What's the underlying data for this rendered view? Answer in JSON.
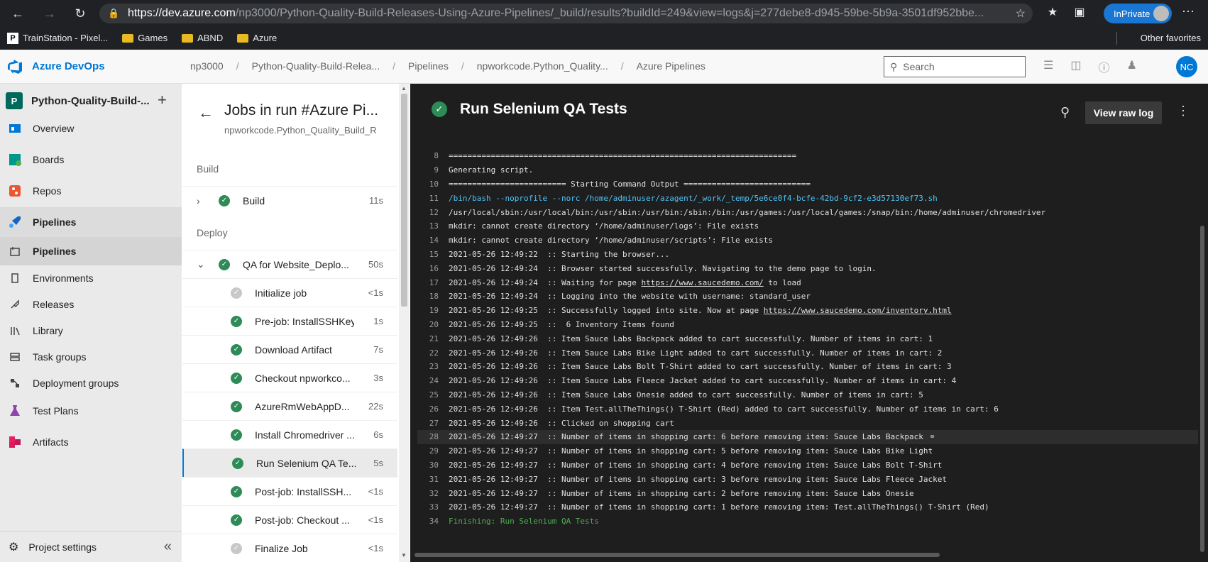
{
  "browser": {
    "url_host": "https://dev.azure.com",
    "url_path": "/np3000/Python-Quality-Build-Releases-Using-Azure-Pipelines/_build/results?buildId=249&view=logs&j=277debe8-d945-59be-5b9a-3501df952bbe...",
    "inprivate": "InPrivate",
    "bookmarks": [
      "TrainStation - Pixel...",
      "Games",
      "ABND",
      "Azure"
    ],
    "other_favorites": "Other favorites"
  },
  "ado": {
    "brand": "Azure DevOps",
    "breadcrumbs": [
      "np3000",
      "Python-Quality-Build-Relea...",
      "Pipelines",
      "npworkcode.Python_Quality...",
      "Azure Pipelines"
    ],
    "search_placeholder": "Search",
    "avatar_initials": "NC"
  },
  "sidebar": {
    "project_badge": "P",
    "project_name": "Python-Quality-Build-...",
    "items": [
      {
        "label": "Overview"
      },
      {
        "label": "Boards"
      },
      {
        "label": "Repos"
      },
      {
        "label": "Pipelines"
      },
      {
        "label": "Pipelines"
      },
      {
        "label": "Environments"
      },
      {
        "label": "Releases"
      },
      {
        "label": "Library"
      },
      {
        "label": "Task groups"
      },
      {
        "label": "Deployment groups"
      },
      {
        "label": "Test Plans"
      },
      {
        "label": "Artifacts"
      }
    ],
    "project_settings": "Project settings"
  },
  "jobs": {
    "title": "Jobs in run #Azure Pi...",
    "subtitle": "npworkcode.Python_Quality_Build_R",
    "build_section": "Build",
    "deploy_section": "Deploy",
    "rows": [
      {
        "label": "Build",
        "duration": "11s"
      },
      {
        "label": "QA for Website_Deplo...",
        "duration": "50s"
      },
      {
        "label": "Initialize job",
        "duration": "<1s"
      },
      {
        "label": "Pre-job: InstallSSHKey",
        "duration": "1s"
      },
      {
        "label": "Download Artifact",
        "duration": "7s"
      },
      {
        "label": "Checkout npworkco...",
        "duration": "3s"
      },
      {
        "label": "AzureRmWebAppD...",
        "duration": "22s"
      },
      {
        "label": "Install Chromedriver ...",
        "duration": "6s"
      },
      {
        "label": "Run Selenium QA Te...",
        "duration": "5s"
      },
      {
        "label": "Post-job: InstallSSH...",
        "duration": "<1s"
      },
      {
        "label": "Post-job: Checkout ...",
        "duration": "<1s"
      },
      {
        "label": "Finalize Job",
        "duration": "<1s"
      }
    ]
  },
  "log": {
    "title": "Run Selenium QA Tests",
    "raw_log_button": "View raw log",
    "lines": [
      {
        "n": "8",
        "t": "=========================================================================="
      },
      {
        "n": "9",
        "t": "Generating script."
      },
      {
        "n": "10",
        "t": "========================= Starting Command Output ==========================="
      },
      {
        "n": "11",
        "t": "/bin/bash --noprofile --norc /home/adminuser/azagent/_work/_temp/5e6ce0f4-bcfe-42bd-9cf2-e3d57130ef73.sh"
      },
      {
        "n": "12",
        "t": "/usr/local/sbin:/usr/local/bin:/usr/sbin:/usr/bin:/sbin:/bin:/usr/games:/usr/local/games:/snap/bin:/home/adminuser/chromedriver"
      },
      {
        "n": "13",
        "t": "mkdir: cannot create directory ‘/home/adminuser/logs’: File exists"
      },
      {
        "n": "14",
        "t": "mkdir: cannot create directory ‘/home/adminuser/scripts’: File exists"
      },
      {
        "n": "15",
        "t": "2021-05-26 12:49:22  :: Starting the browser..."
      },
      {
        "n": "16",
        "t": "2021-05-26 12:49:24  :: Browser started successfully. Navigating to the demo page to login."
      },
      {
        "n": "17",
        "t": "2021-05-26 12:49:24  :: Waiting for page ",
        "link": "https://www.saucedemo.com/",
        "tail": " to load"
      },
      {
        "n": "18",
        "t": "2021-05-26 12:49:24  :: Logging into the website with username: standard_user"
      },
      {
        "n": "19",
        "t": "2021-05-26 12:49:25  :: Successfully logged into site. Now at page ",
        "link": "https://www.saucedemo.com/inventory.html",
        "tail": ""
      },
      {
        "n": "20",
        "t": "2021-05-26 12:49:25  ::  6 Inventory Items found"
      },
      {
        "n": "21",
        "t": "2021-05-26 12:49:26  :: Item Sauce Labs Backpack added to cart successfully. Number of items in cart: 1"
      },
      {
        "n": "22",
        "t": "2021-05-26 12:49:26  :: Item Sauce Labs Bike Light added to cart successfully. Number of items in cart: 2"
      },
      {
        "n": "23",
        "t": "2021-05-26 12:49:26  :: Item Sauce Labs Bolt T-Shirt added to cart successfully. Number of items in cart: 3"
      },
      {
        "n": "24",
        "t": "2021-05-26 12:49:26  :: Item Sauce Labs Fleece Jacket added to cart successfully. Number of items in cart: 4"
      },
      {
        "n": "25",
        "t": "2021-05-26 12:49:26  :: Item Sauce Labs Onesie added to cart successfully. Number of items in cart: 5"
      },
      {
        "n": "26",
        "t": "2021-05-26 12:49:26  :: Item Test.allTheThings() T-Shirt (Red) added to cart successfully. Number of items in cart: 6"
      },
      {
        "n": "27",
        "t": "2021-05-26 12:49:26  :: Clicked on shopping cart"
      },
      {
        "n": "28",
        "t": "2021-05-26 12:49:27  :: Number of items in shopping cart: 6 before removing item: Sauce Labs Backpack"
      },
      {
        "n": "29",
        "t": "2021-05-26 12:49:27  :: Number of items in shopping cart: 5 before removing item: Sauce Labs Bike Light"
      },
      {
        "n": "30",
        "t": "2021-05-26 12:49:27  :: Number of items in shopping cart: 4 before removing item: Sauce Labs Bolt T-Shirt"
      },
      {
        "n": "31",
        "t": "2021-05-26 12:49:27  :: Number of items in shopping cart: 3 before removing item: Sauce Labs Fleece Jacket"
      },
      {
        "n": "32",
        "t": "2021-05-26 12:49:27  :: Number of items in shopping cart: 2 before removing item: Sauce Labs Onesie"
      },
      {
        "n": "33",
        "t": "2021-05-26 12:49:27  :: Number of items in shopping cart: 1 before removing item: Test.allTheThings() T-Shirt (Red)"
      },
      {
        "n": "34",
        "t": "Finishing: Run Selenium QA Tests"
      }
    ]
  }
}
